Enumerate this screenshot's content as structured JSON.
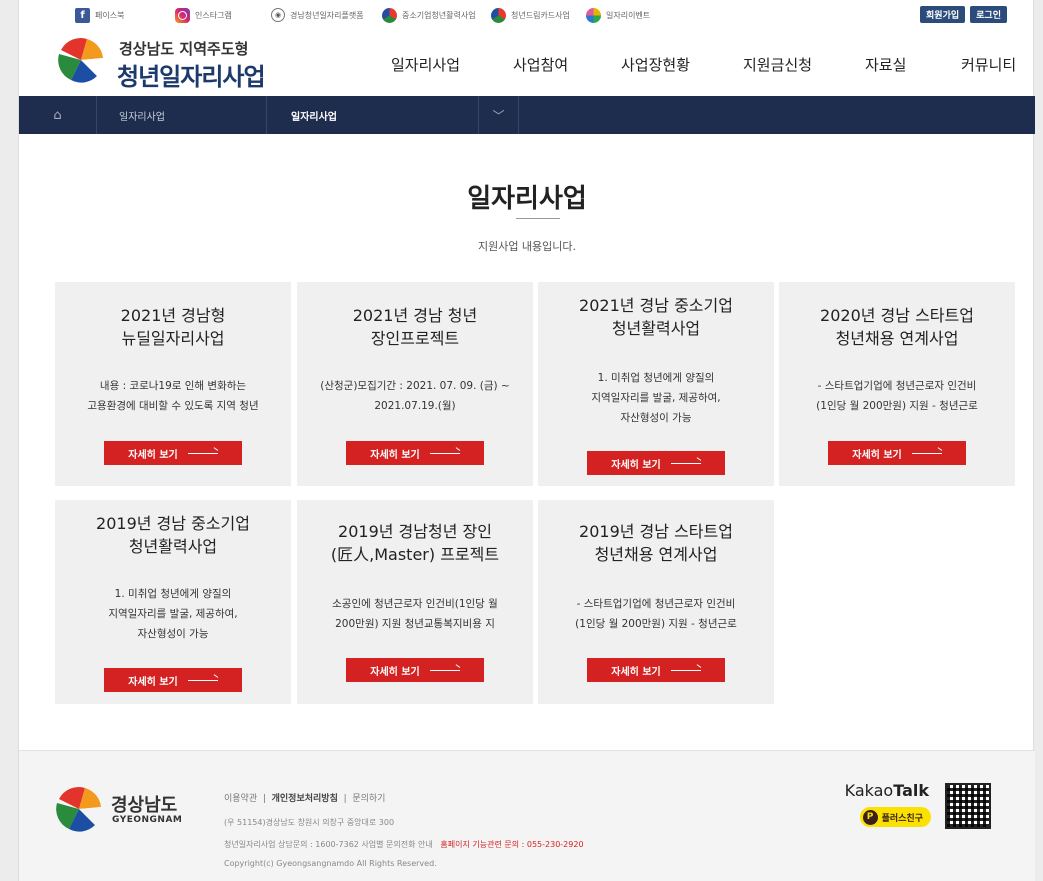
{
  "topbar": {
    "links": [
      {
        "label": "페이스북",
        "icon": "facebook-icon"
      },
      {
        "label": "인스타그램",
        "icon": "instagram-icon"
      },
      {
        "label": "경남청년일자리플랫폼",
        "icon": "platform-icon"
      },
      {
        "label": "중소기업청년활력사업",
        "icon": "wheel-icon"
      },
      {
        "label": "청년드림카드사업",
        "icon": "wheel-icon"
      },
      {
        "label": "일자리이벤트",
        "icon": "pinwheel-icon"
      }
    ],
    "join_label": "회원가입",
    "login_label": "로그인"
  },
  "header": {
    "brand_sub": "경상남도 지역주도형",
    "brand_main": "청년일자리사업",
    "nav": [
      "일자리사업",
      "사업참여",
      "사업장현황",
      "지원금신청",
      "자료실",
      "커뮤니티"
    ]
  },
  "subnav": {
    "home_icon": "home-icon",
    "crumb1": "일자리사업",
    "crumb2": "일자리사업"
  },
  "main": {
    "title": "일자리사업",
    "desc": "지원사업 내용입니다.",
    "button_label": "자세히 보기",
    "cards": [
      {
        "title1": "2021년 경남형",
        "title2": "뉴딜일자리사업",
        "body1": "내용 : 코로나19로 인해 변화하는",
        "body2": "고용환경에 대비할 수 있도록 지역 청년",
        "body3": ""
      },
      {
        "title1": "2021년 경남 청년",
        "title2": "장인프로젝트",
        "body1": "(산청군)모집기간 : 2021. 07. 09. (금) ~",
        "body2": "2021.07.19.(월)",
        "body3": ""
      },
      {
        "title1": "2021년 경남 중소기업",
        "title2": "청년활력사업",
        "body1": "1. 미취업 청년에게 양질의",
        "body2": "지역일자리를 발굴, 제공하여,",
        "body3": "자산형성이 가능"
      },
      {
        "title1": "2020년 경남 스타트업",
        "title2": "청년채용 연계사업",
        "body1": "- 스타트업기업에 청년근로자 인건비",
        "body2": "(1인당 월 200만원) 지원 - 청년근로",
        "body3": ""
      },
      {
        "title1": "2019년 경남 중소기업",
        "title2": "청년활력사업",
        "body1": "1. 미취업 청년에게 양질의",
        "body2": "지역일자리를 발굴, 제공하여,",
        "body3": "자산형성이 가능"
      },
      {
        "title1": "2019년 경남청년 장인",
        "title2": "(匠人,Master) 프로젝트",
        "body1": "소공인에 청년근로자 인건비(1인당 월",
        "body2": "200만원) 지원 청년교통복지비용 지",
        "body3": ""
      },
      {
        "title1": "2019년 경남 스타트업",
        "title2": "청년채용 연계사업",
        "body1": "- 스타트업기업에 청년근로자 인건비",
        "body2": "(1인당 월 200만원) 지원 - 청년근로",
        "body3": ""
      }
    ]
  },
  "footer": {
    "name": "경상남도",
    "name_en": "GYEONGNAM",
    "link_terms": "이용약관",
    "link_privacy": "개인정보처리방침",
    "link_inquiry": "문의하기",
    "address": "(우 51154)경상남도 창원시 의창구 중앙대로 300",
    "contact": "청년일자리사업 상담문의 : 1600-7362  사업별 문의전화 안내",
    "contact_red": "홈페이지 기능관련 문의 : 055-230-2920",
    "copyright": "Copyright(c) Gyeongsangnamdo All Rights Reserved.",
    "kakao_a": "Kakao",
    "kakao_b": "Talk",
    "plus_label": "플러스친구",
    "plus_icon": "P"
  }
}
